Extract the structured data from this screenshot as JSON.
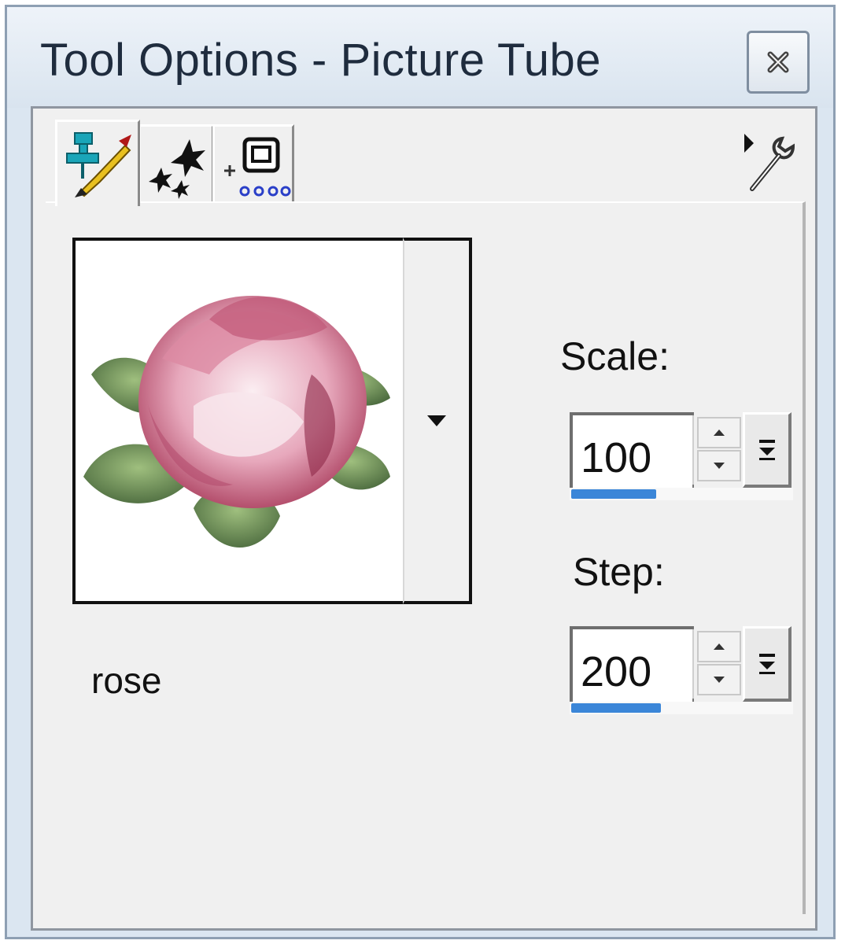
{
  "window": {
    "title": "Tool Options - Picture Tube",
    "close_icon": "close-icon"
  },
  "tabs": [
    {
      "icon": "brush-pin-icon",
      "active": true
    },
    {
      "icon": "scatter-stars-icon",
      "active": false
    },
    {
      "icon": "layout-grid-icon",
      "active": false
    }
  ],
  "menu_toggle_icon": "presets-menu-icon",
  "tube": {
    "preview_icon": "rose-image",
    "name": "rose",
    "dropdown_icon": "chevron-down-icon"
  },
  "scale": {
    "label": "Scale:",
    "value": "100",
    "level": 0.38
  },
  "step": {
    "label": "Step:",
    "value": "200",
    "level": 0.4
  },
  "colors": {
    "accent": "#3b86d8",
    "panel": "#f0f0f0",
    "title_bar": "#dbe6f1"
  }
}
